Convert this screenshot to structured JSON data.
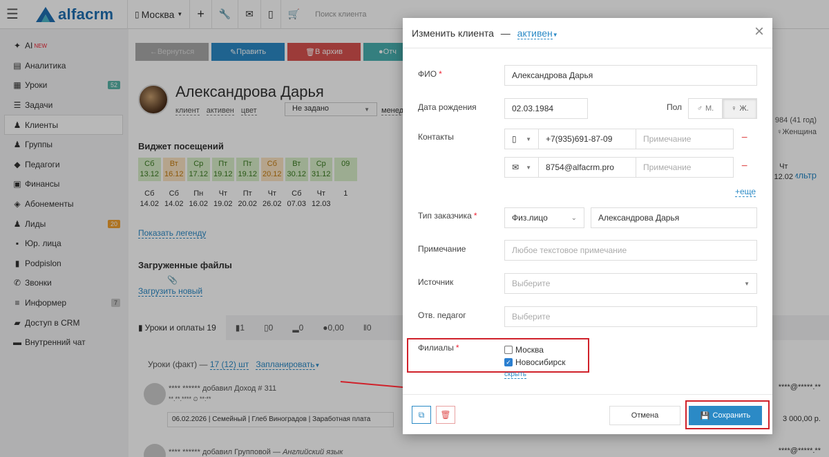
{
  "app": {
    "logo": "alfacrm",
    "branch": "Москва",
    "search_placeholder": "Поиск клиента"
  },
  "sidebar": {
    "items": [
      {
        "label": "AI",
        "tag": "NEW",
        "icon": "sparkle-icon"
      },
      {
        "label": "Аналитика",
        "icon": "book-icon"
      },
      {
        "label": "Уроки",
        "badge": "52",
        "icon": "calendar-icon"
      },
      {
        "label": "Задачи",
        "icon": "tasks-icon"
      },
      {
        "label": "Клиенты",
        "icon": "user-icon",
        "active": true
      },
      {
        "label": "Группы",
        "icon": "users-icon"
      },
      {
        "label": "Педагоги",
        "icon": "graduation-icon"
      },
      {
        "label": "Финансы",
        "icon": "money-icon"
      },
      {
        "label": "Абонементы",
        "icon": "tag-icon"
      },
      {
        "label": "Лиды",
        "badge": "20",
        "icon": "lead-icon"
      },
      {
        "label": "Юр. лица",
        "icon": "briefcase-icon"
      },
      {
        "label": "Podpislon",
        "icon": "document-icon"
      },
      {
        "label": "Звонки",
        "icon": "phone-icon"
      },
      {
        "label": "Информер",
        "badge": "7",
        "icon": "list-icon"
      },
      {
        "label": "Доступ в CRM",
        "icon": "lock-icon"
      },
      {
        "label": "Внутренний чат",
        "icon": "chat-icon"
      }
    ]
  },
  "client": {
    "name": "Александрова Дарья",
    "tags": [
      "клиент",
      "активен",
      "цвет"
    ],
    "select_value": "Не задано",
    "manager_label": "менедж",
    "age_info": "984 (41 год)",
    "gender_info": "Женщина",
    "filter": "Фильтр"
  },
  "actions": {
    "back": "Вернуться",
    "edit": "Править",
    "archive": "В архив",
    "note": "Отч"
  },
  "visits": {
    "title": "Виджет посещений",
    "row1": [
      {
        "d": "Сб",
        "n": "13.12",
        "s": "g"
      },
      {
        "d": "Вт",
        "n": "16.12",
        "s": "o"
      },
      {
        "d": "Ср",
        "n": "17.12",
        "s": "g"
      },
      {
        "d": "Пт",
        "n": "19.12",
        "s": "g"
      },
      {
        "d": "Пт",
        "n": "19.12",
        "s": "g"
      },
      {
        "d": "Сб",
        "n": "20.12",
        "s": "o"
      },
      {
        "d": "Вт",
        "n": "30.12",
        "s": "g"
      },
      {
        "d": "Ср",
        "n": "31.12",
        "s": "g"
      },
      {
        "d": "",
        "n": "09",
        "s": "g"
      }
    ],
    "row2": [
      {
        "d": "Сб",
        "n": "14.02"
      },
      {
        "d": "Сб",
        "n": "14.02"
      },
      {
        "d": "Пн",
        "n": "16.02"
      },
      {
        "d": "Чт",
        "n": "19.02"
      },
      {
        "d": "Пт",
        "n": "20.02"
      },
      {
        "d": "Чт",
        "n": "26.02"
      },
      {
        "d": "Сб",
        "n": "07.03"
      },
      {
        "d": "Чт",
        "n": "12.03"
      },
      {
        "d": "",
        "n": "1"
      }
    ],
    "extra": {
      "d": "Чт",
      "n": "12.02"
    },
    "legend_link": "Показать легенду"
  },
  "files": {
    "title": "Загруженные файлы",
    "upload": "Загрузить новый"
  },
  "tabs": [
    "Уроки и оплаты 19",
    "1",
    "0",
    "0",
    "0,00",
    "0"
  ],
  "lessons": {
    "prefix": "Уроки (факт) —",
    "count": "17 (12) шт",
    "planned": "Запланировать"
  },
  "feed": [
    {
      "author": "**** ******",
      "action": "добавил Доход # 311",
      "meta": "**.**.**** ⏲ **:**",
      "box": "06.02.2026 | Семейный | Глеб Виноградов | Заработная плата",
      "amount": "3 000,00 р.",
      "email": "****@*****.**"
    },
    {
      "author": "**** ******",
      "action": "добавил Групповой —",
      "extra": "Английский язык",
      "email": "****@*****.**"
    }
  ],
  "modal": {
    "title": "Изменить клиента",
    "dash": "—",
    "status": "активен",
    "fields": {
      "fio_label": "ФИО",
      "fio_value": "Александрова Дарья",
      "dob_label": "Дата рождения",
      "dob_value": "02.03.1984",
      "gender_label": "Пол",
      "gender_m": "М.",
      "gender_f": "Ж.",
      "contacts_label": "Контакты",
      "phone": "+7(935)691-87-09",
      "email": "8754@alfacrm.pro",
      "note_placeholder": "Примечание",
      "more": "+еще",
      "customer_type_label": "Тип заказчика",
      "customer_type": "Физ.лицо",
      "customer_name": "Александрова Дарья",
      "note_label": "Примечание",
      "note_text_placeholder": "Любое текстовое примечание",
      "source_label": "Источник",
      "source_placeholder": "Выберите",
      "teacher_label": "Отв. педагог",
      "teacher_placeholder": "Выберите",
      "branches_label": "Филиалы",
      "branches": [
        {
          "name": "Москва",
          "checked": false
        },
        {
          "name": "Новосибирск",
          "checked": true
        }
      ],
      "hide": "скрыть"
    },
    "cancel": "Отмена",
    "save": "Сохранить"
  },
  "colors": {
    "accent": "#2b8ac6",
    "highlight": "#d0212a",
    "brand": "#1f6fb2"
  }
}
